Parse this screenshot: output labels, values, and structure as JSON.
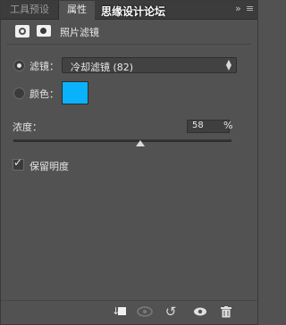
{
  "tabs": [
    {
      "label": "工具预设"
    },
    {
      "label": "属性"
    }
  ],
  "watermark": "思缘设计论坛",
  "tab_icons": {
    "collapse": "»",
    "menu": "≡"
  },
  "header": {
    "title": "照片滤镜"
  },
  "filter": {
    "label": "滤镜：",
    "value": "冷却滤镜 (82)"
  },
  "color": {
    "label": "颜色：",
    "value": "#0ab2fb"
  },
  "density": {
    "label": "浓度：",
    "value": "58",
    "unit": "%"
  },
  "preserve_luminosity": {
    "label": "保留明度",
    "checked": true
  },
  "toolbar": {
    "clip": "clip-to-layer",
    "visibility_prev": "view-previous",
    "reset": "↺",
    "eye": "visibility",
    "delete": "delete"
  }
}
